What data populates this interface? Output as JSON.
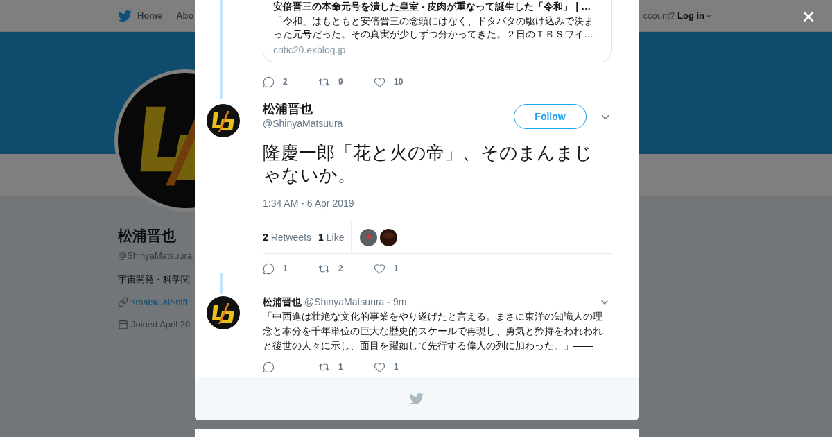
{
  "background_page": {
    "nav": [
      {
        "label": "Home",
        "kind": "bird"
      },
      {
        "label": "Abo",
        "kind": "plain"
      }
    ],
    "account_prompt": "ccount?",
    "login": "Log in",
    "profile": {
      "name": "松浦晋也",
      "handle": "@ShinyaMatsuura",
      "bio": "宇宙開発・科学関",
      "link": "smatsu.air-nift",
      "joined": "Joined April 20"
    }
  },
  "thread": {
    "quote_card": {
      "title": "安倍晋三の本命元号を潰した皇室 - 皮肉が重なって誕生した「令和」 | …",
      "description": "「令和」はもともと安倍晋三の念頭にはなく、ドタバタの駆け込みで決まった元号だった。その真実が少しずつ分かってきた。２日のＴＢＳワイ…",
      "domain": "critic20.exblog.jp"
    },
    "top_actions": {
      "replies": "2",
      "retweets": "9",
      "likes": "10"
    },
    "tweet": {
      "name": "松浦晋也",
      "handle": "@ShinyaMatsuura",
      "follow": "Follow",
      "text": "隆慶一郎「花と火の帝」、そのまんまじゃないか。",
      "time": "1:34 AM - 6 Apr 2019",
      "retweets_count": "2",
      "retweets_label": "Retweets",
      "likes_count": "1",
      "likes_label": "Like",
      "actions": {
        "replies": "1",
        "retweets": "2",
        "likes": "1"
      }
    },
    "reply": {
      "name": "松浦晋也",
      "handle": "@ShinyaMatsuura",
      "separator": "·",
      "time": "9m",
      "text": "「中西進は壮絶な文化的事業をやり遂げたと言える。まさに東洋の知識人の理念と本分を千年単位の巨大な歴史的スケールで再現し、勇気と矜持をわれわれと後世の人々に示し、面目を躍如して先行する偉人の列に加わった。」――",
      "actions": {
        "retweets": "1",
        "likes": "1"
      }
    }
  }
}
